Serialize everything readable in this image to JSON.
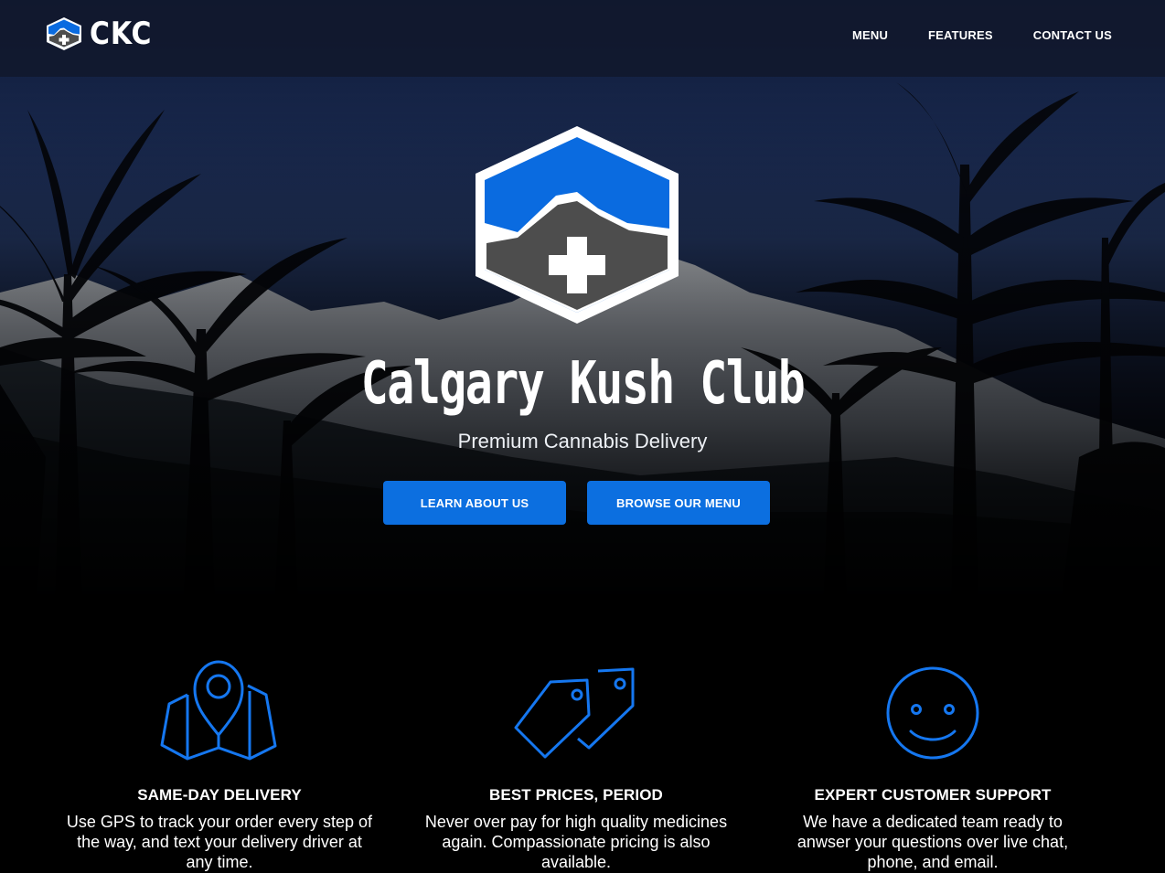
{
  "brand": {
    "name": "CKC",
    "logo_icon": "hexagon-mountain-cross-icon"
  },
  "nav": {
    "items": [
      {
        "label": "MENU"
      },
      {
        "label": "FEATURES"
      },
      {
        "label": "CONTACT US"
      }
    ]
  },
  "hero": {
    "title": "Calgary Kush Club",
    "subtitle": "Premium Cannabis Delivery",
    "buttons": [
      {
        "label": "LEARN ABOUT US"
      },
      {
        "label": "BROWSE OUR MENU"
      }
    ],
    "background": "mountains-and-cannabis-leaves-photo"
  },
  "features": [
    {
      "icon": "map-pin-icon",
      "title": "SAME-DAY DELIVERY",
      "description": "Use GPS to track your order every step of the way, and text your delivery driver at any time."
    },
    {
      "icon": "price-tags-icon",
      "title": "BEST PRICES, PERIOD",
      "description": "Never over pay for high quality medicines again. Compassionate pricing is also available."
    },
    {
      "icon": "smiley-face-icon",
      "title": "EXPERT CUSTOMER SUPPORT",
      "description": "We have a dedicated team ready to anwser your questions over live chat, phone, and email."
    }
  ],
  "colors": {
    "accent": "#0c6fe0",
    "logo_blue": "#0a6be0",
    "logo_gray": "#4d4d4d",
    "navbar": "#11182c"
  }
}
